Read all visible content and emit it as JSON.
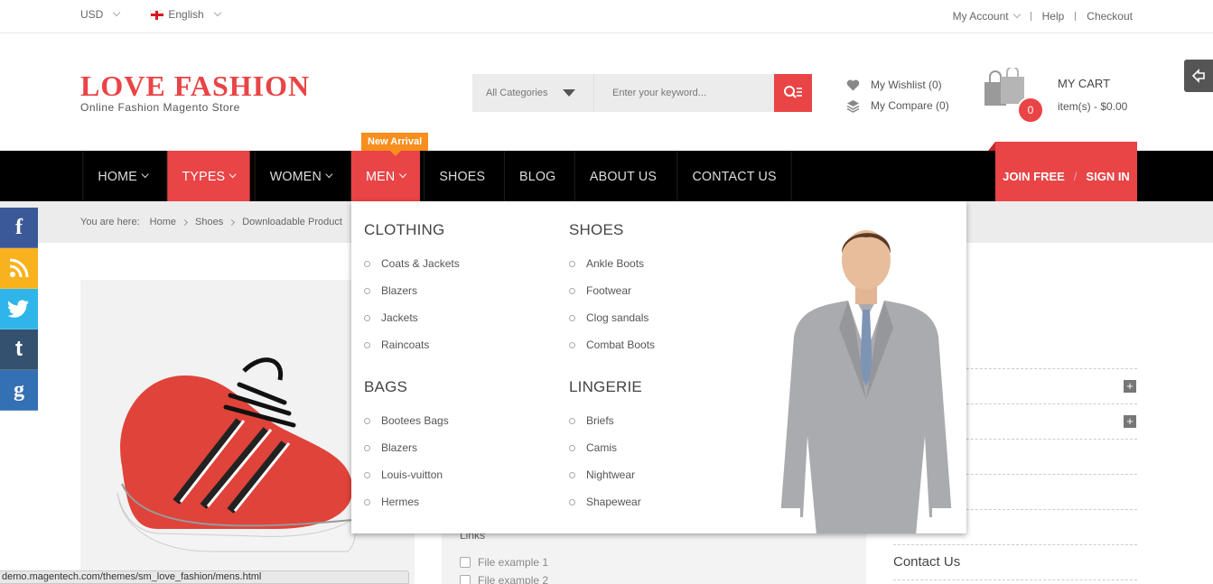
{
  "topbar": {
    "currency": "USD",
    "language": "English",
    "links": [
      "My Account",
      "Help",
      "Checkout"
    ]
  },
  "brand": {
    "title": "LOVE FASHION",
    "subtitle": "Online Fashion Magento Store",
    "accent": "#e94446"
  },
  "search": {
    "category": "All Categories",
    "placeholder": "Enter your keyword..."
  },
  "wishlist": {
    "wishlist": "My Wishlist (0)",
    "compare": "My Compare (0)"
  },
  "cart": {
    "title": "MY CART",
    "count": "0",
    "summary": "item(s) - $0.00"
  },
  "nav": {
    "badge": "New Arrival",
    "items": [
      "HOME",
      "TYPES",
      "WOMEN",
      "MEN",
      "SHOES",
      "BLOG",
      "ABOUT US",
      "CONTACT US"
    ],
    "join": "JOIN FREE",
    "signin": "SIGN IN"
  },
  "breadcrumb": {
    "prefix": "You are here:",
    "items": [
      "Home",
      "Shoes",
      "Downloadable Product"
    ]
  },
  "menu": {
    "clothing": {
      "title": "CLOTHING",
      "items": [
        "Coats & Jackets",
        "Blazers",
        "Jackets",
        "Raincoats"
      ]
    },
    "shoes": {
      "title": "SHOES",
      "items": [
        "Ankle Boots",
        "Footwear",
        "Clog sandals",
        "Combat Boots"
      ]
    },
    "bags": {
      "title": "BAGS",
      "items": [
        "Bootees Bags",
        "Blazers",
        "Louis-vuitton",
        "Hermes"
      ]
    },
    "lingerie": {
      "title": "LINGERIE",
      "items": [
        "Briefs",
        "Camis",
        "Nightwear",
        "Shapewear"
      ]
    }
  },
  "content": {
    "links_label": "Links",
    "files": [
      "File example 1",
      "File example 2"
    ],
    "contact": "Contact Us"
  },
  "status_url": "demo.magentech.com/themes/sm_love_fashion/mens.html",
  "social": {
    "facebook": "f",
    "rss": "rss-icon",
    "twitter": "twitter-icon",
    "tumblr": "t",
    "google": "g",
    "colors": {
      "facebook": "#3b5998",
      "rss": "#f8b21d",
      "twitter": "#2fb5ea",
      "tumblr": "#34526f",
      "google": "#3470b4"
    }
  }
}
